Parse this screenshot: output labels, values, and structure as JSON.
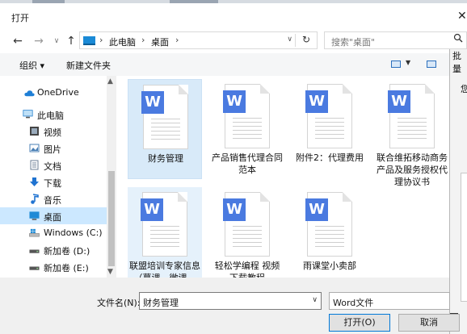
{
  "dialog": {
    "title": "打开",
    "close_glyph": "✕"
  },
  "nav": {
    "back": "←",
    "forward": "→",
    "recent": "∨",
    "up": "↑",
    "address": {
      "crumbs": [
        "此电脑",
        "桌面"
      ],
      "sep": "›",
      "dropdown": "∨",
      "refresh": "↻"
    },
    "search_placeholder": "搜索\"桌面\"",
    "search_icon": "search-icon"
  },
  "toolbar": {
    "organize": "组织 ▾",
    "new_folder": "新建文件夹",
    "view_dropdown": "▼"
  },
  "sidebar": {
    "items": [
      {
        "label": "OneDrive",
        "icon": "cloud-icon",
        "color": "#1f7fd6"
      },
      {
        "label": "此电脑",
        "icon": "computer-icon",
        "color": "#2b83cf"
      },
      {
        "label": "视频",
        "icon": "video-icon",
        "color": "#555555"
      },
      {
        "label": "图片",
        "icon": "picture-icon",
        "color": "#4a7fb5"
      },
      {
        "label": "文档",
        "icon": "document-icon",
        "color": "#6e7f95"
      },
      {
        "label": "下载",
        "icon": "download-icon",
        "color": "#1f73d1"
      },
      {
        "label": "音乐",
        "icon": "music-icon",
        "color": "#1f73d1"
      },
      {
        "label": "桌面",
        "icon": "desktop-icon",
        "color": "#1f8ad6",
        "selected": true
      },
      {
        "label": "Windows (C:)",
        "icon": "windows-drive-icon",
        "color": "#1f8ad6"
      },
      {
        "label": "新加卷 (D:)",
        "icon": "drive-icon",
        "color": "#555555"
      },
      {
        "label": "新加卷 (E:)",
        "icon": "drive-icon",
        "color": "#555555"
      }
    ],
    "scroll_up": "▲",
    "scroll_down": "▼"
  },
  "files": [
    {
      "name": "财务管理",
      "state": "selected"
    },
    {
      "name": "产品销售代理合同范本",
      "state": "normal"
    },
    {
      "name": "附件2：代理费用",
      "state": "normal"
    },
    {
      "name": "联合维拓移动商务产品及服务授权代理协议书",
      "state": "normal"
    },
    {
      "name": "联盟培训专家信息（慕课、微课、录...",
      "state": "hover"
    },
    {
      "name": "轻松学编程 视频下载教程",
      "state": "normal"
    },
    {
      "name": "雨课堂小卖部",
      "state": "normal"
    }
  ],
  "word_badge": "W",
  "footer": {
    "filename_label": "文件名(N):",
    "filename_value": "财务管理",
    "filename_dropdown": "∨",
    "filetype_value": "Word文件",
    "open_button": "打开(O)",
    "cancel_button": "取消"
  },
  "right_panel": {
    "header": "批量",
    "text": "您"
  },
  "colors": {
    "accent": "#0078d7",
    "selection": "#cce8ff",
    "word_blue": "#4a7ae0"
  }
}
